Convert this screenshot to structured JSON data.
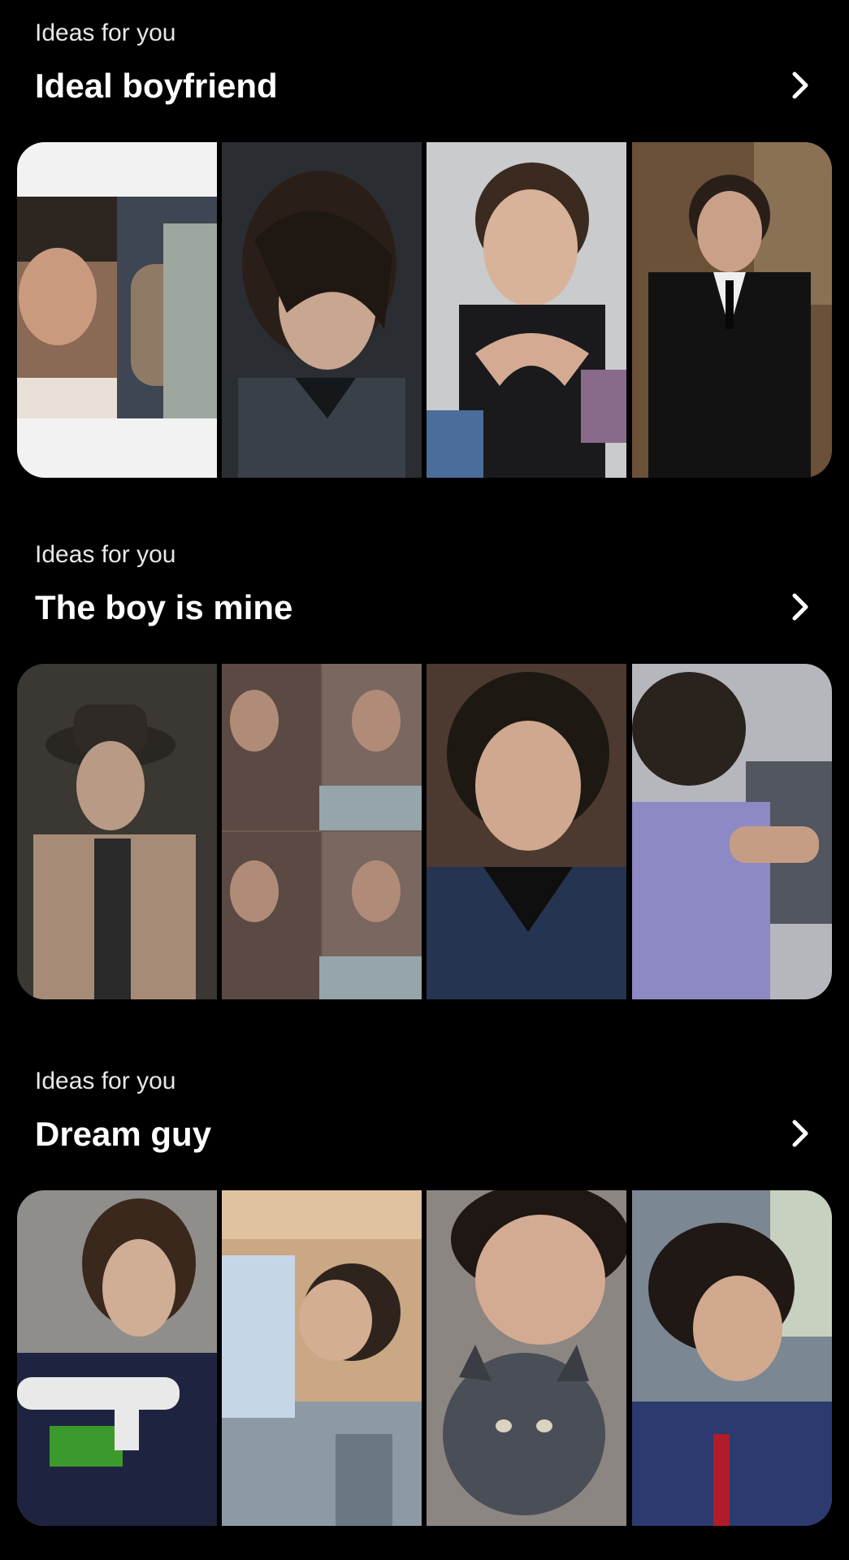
{
  "sections": [
    {
      "kicker": "Ideas for you",
      "title": "Ideal boyfriend",
      "chevron_icon": "chevron-right-icon",
      "pins": [
        {
          "description_tag": "side-by-side-collage",
          "bg": "#f2f2f2"
        },
        {
          "description_tag": "portrait-dark-hair",
          "bg": "#262a30"
        },
        {
          "description_tag": "portrait-hand-heart",
          "bg": "#c9cbcc"
        },
        {
          "description_tag": "portrait-black-suit",
          "bg": "#6b5138"
        }
      ]
    },
    {
      "kicker": "Ideas for you",
      "title": "The boy is mine",
      "chevron_icon": "chevron-right-icon",
      "pins": [
        {
          "description_tag": "portrait-hat",
          "bg": "#3b3732"
        },
        {
          "description_tag": "grid-collage-four",
          "bg": "#6e5c54"
        },
        {
          "description_tag": "portrait-plaid-shirt",
          "bg": "#4c3a30"
        },
        {
          "description_tag": "portrait-gym",
          "bg": "#b5b7bd"
        }
      ]
    },
    {
      "kicker": "Ideas for you",
      "title": "Dream guy",
      "chevron_icon": "chevron-right-icon",
      "pins": [
        {
          "description_tag": "portrait-racing-jacket",
          "bg": "#8f8e8a"
        },
        {
          "description_tag": "portrait-skyline",
          "bg": "#caa884"
        },
        {
          "description_tag": "portrait-with-cat",
          "bg": "#8c8682"
        },
        {
          "description_tag": "portrait-car-seat",
          "bg": "#7b8793"
        }
      ]
    }
  ],
  "colors": {
    "background": "#000000",
    "text_primary": "#ffffff",
    "text_secondary": "#e8e8e8"
  }
}
